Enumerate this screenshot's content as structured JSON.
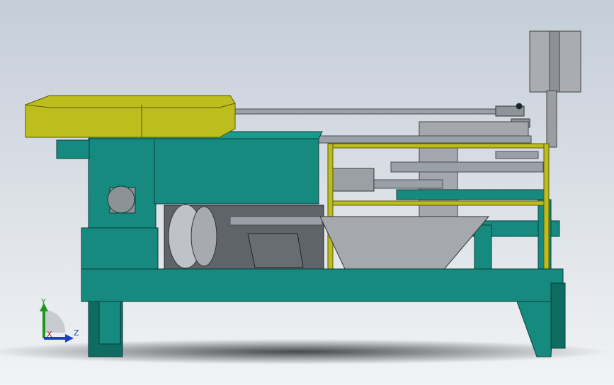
{
  "viewport": {
    "background_top": "#c5cdd8",
    "background_bottom": "#f1f3f5"
  },
  "model": {
    "frame_color": "#168a7f",
    "frame_dark": "#0e6c63",
    "hopper_color": "#bdbd1d",
    "rail_color": "#bdbd1d",
    "metal_color": "#9aa0a8",
    "panel_color": "#a7abb1"
  },
  "triad": {
    "y_label": "Y",
    "z_label": "Z",
    "x_label": "X",
    "y_color": "#1a9a1a",
    "z_color": "#1f3fbf",
    "x_color": "#b02020"
  }
}
